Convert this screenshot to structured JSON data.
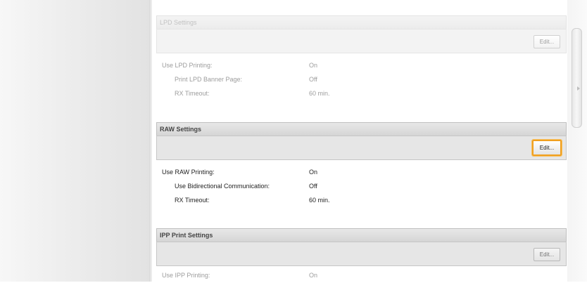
{
  "sections": [
    {
      "title": "LPD Settings",
      "edit_label": "Edit...",
      "rows": [
        {
          "label": "Use LPD Printing:",
          "value": "On"
        },
        {
          "label": "Print LPD Banner Page:",
          "value": "Off"
        },
        {
          "label": "RX Timeout:",
          "value": "60 min."
        }
      ]
    },
    {
      "title": "RAW Settings",
      "edit_label": "Edit...",
      "rows": [
        {
          "label": "Use RAW Printing:",
          "value": "On"
        },
        {
          "label": "Use Bidirectional Communication:",
          "value": "Off"
        },
        {
          "label": "RX Timeout:",
          "value": "60 min."
        }
      ]
    },
    {
      "title": "IPP Print Settings",
      "edit_label": "Edit...",
      "rows": [
        {
          "label": "Use IPP Printing:",
          "value": "On"
        }
      ]
    }
  ],
  "highlight_color": "#f0a020"
}
